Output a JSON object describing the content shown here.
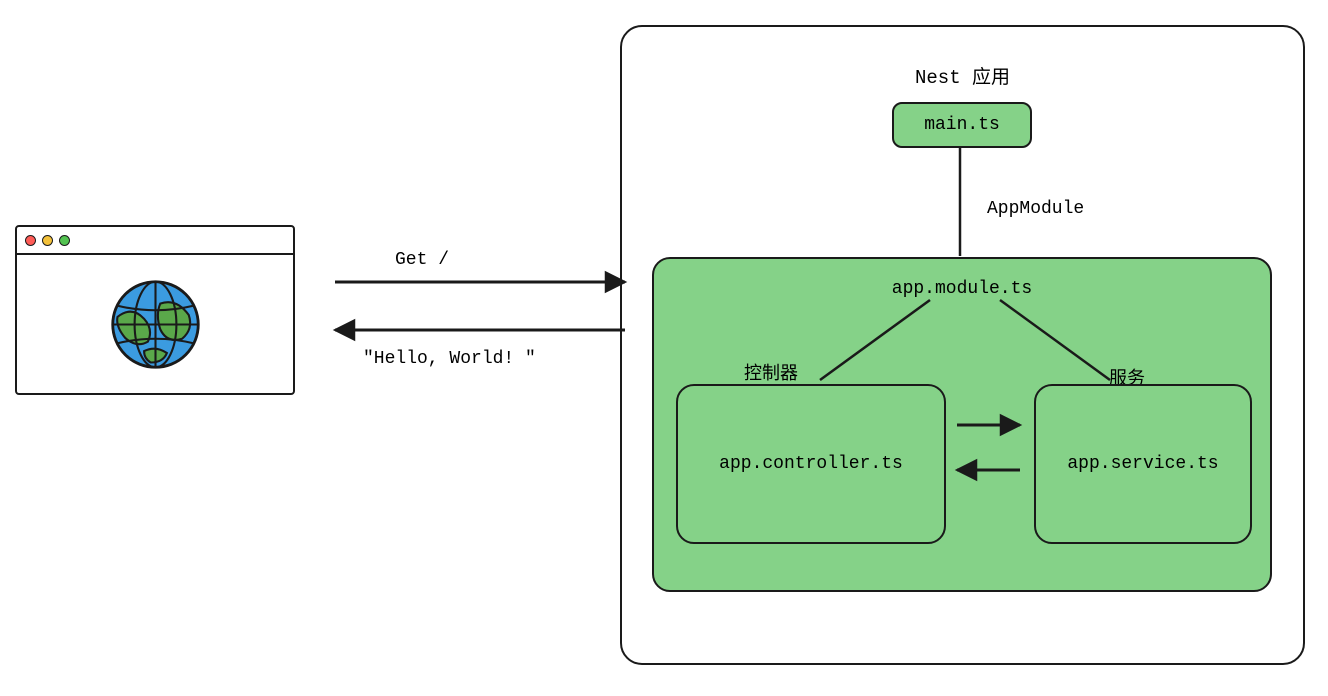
{
  "browser": {
    "icon_name": "globe-icon"
  },
  "request": {
    "label": "Get /"
  },
  "response": {
    "label": "\"Hello, World! \""
  },
  "nest": {
    "title": "Nest 应用",
    "main_file": "main.ts",
    "module_edge_label": "AppModule",
    "module": {
      "file": "app.module.ts",
      "controller_label": "控制器",
      "service_label": "服务",
      "controller_file": "app.controller.ts",
      "service_file": "app.service.ts"
    }
  },
  "colors": {
    "green_fill": "#85d288",
    "stroke": "#1a1a1a"
  }
}
